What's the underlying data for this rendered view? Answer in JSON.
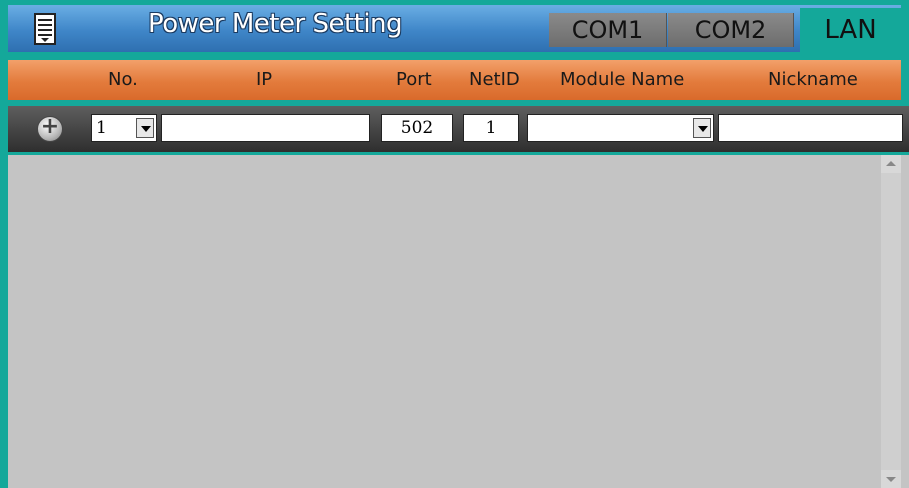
{
  "title": "Power Meter Setting",
  "tabs": {
    "com1": "COM1",
    "com2": "COM2",
    "lan": "LAN"
  },
  "columns": {
    "no": "No.",
    "ip": "IP",
    "port": "Port",
    "netid": "NetID",
    "module": "Module Name",
    "nickname": "Nickname"
  },
  "inputs": {
    "no": "1",
    "ip": "",
    "port": "502",
    "netid": "1",
    "module": "",
    "nickname": ""
  },
  "icons": {
    "menu": "menu-list-icon",
    "add": "add-circle-icon"
  },
  "colors": {
    "accent": "#14a89a",
    "titlebar": "#3f86c8",
    "header": "#e37b3c",
    "body": "#c4c4c4"
  }
}
